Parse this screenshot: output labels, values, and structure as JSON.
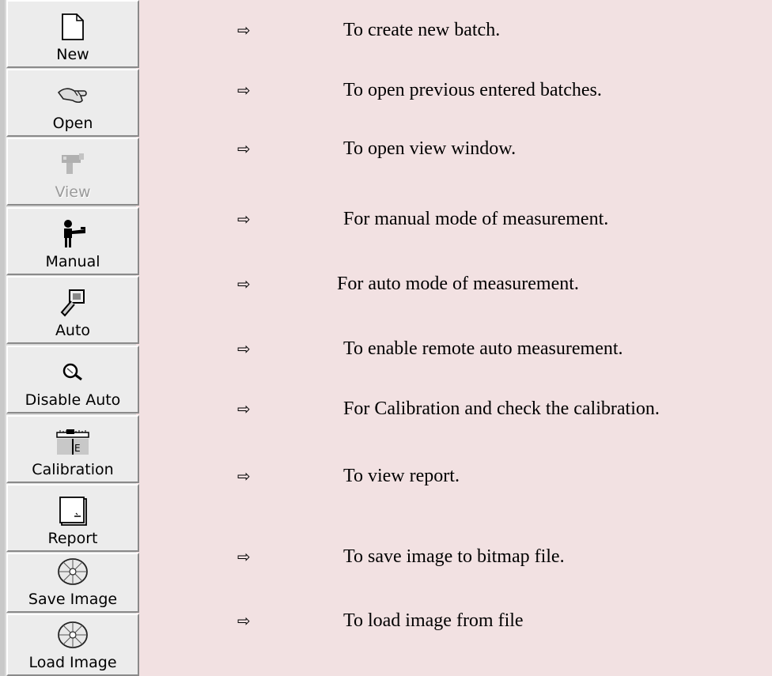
{
  "toolbar": {
    "buttons": [
      {
        "label": "New",
        "icon": "new-document-icon"
      },
      {
        "label": "Open",
        "icon": "open-hand-icon"
      },
      {
        "label": "View",
        "icon": "view-icon"
      },
      {
        "label": "Manual",
        "icon": "manual-icon"
      },
      {
        "label": "Auto",
        "icon": "auto-icon"
      },
      {
        "label": "Disable Auto",
        "icon": "magnifier-icon"
      },
      {
        "label": "Calibration",
        "icon": "calibration-ruler-icon"
      },
      {
        "label": "Report",
        "icon": "report-icon"
      },
      {
        "label": "Save Image",
        "icon": "disc-icon"
      },
      {
        "label": "Load Image",
        "icon": "disc-icon"
      }
    ]
  },
  "descriptions": {
    "arrow": "⇨",
    "items": [
      "To create new batch.",
      "To open previous entered batches.",
      "To open view window.",
      "For manual mode of measurement.",
      "For auto mode of measurement.",
      "To enable remote auto measurement.",
      "For Calibration and  check the calibration.",
      "To view report.",
      "To save image to bitmap file.",
      "To load image from file"
    ]
  }
}
